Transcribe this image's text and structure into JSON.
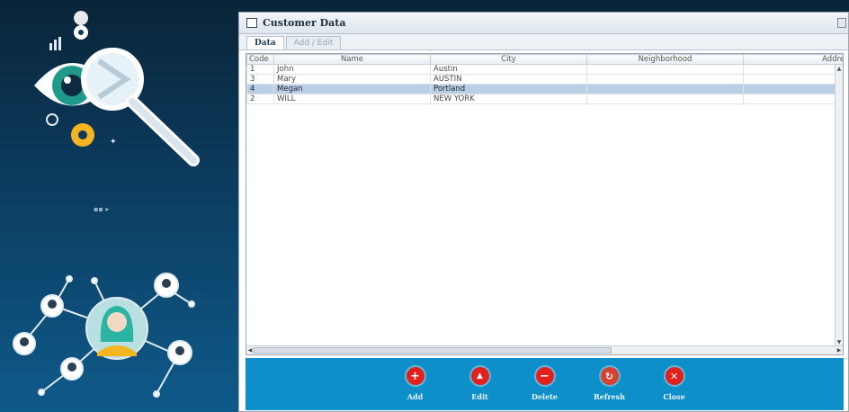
{
  "window": {
    "title": "Customer Data",
    "tabs": [
      "Data",
      "Add / Edit"
    ]
  },
  "table": {
    "columns": [
      "Code",
      "Name",
      "City",
      "Neighborhood",
      "Address"
    ],
    "rows": [
      {
        "code": "1",
        "name": "John",
        "city": "Austin",
        "neighborhood": "",
        "address": ""
      },
      {
        "code": "3",
        "name": "Mary",
        "city": "AUSTIN",
        "neighborhood": "",
        "address": ""
      },
      {
        "code": "4",
        "name": "Megan",
        "city": "Portland",
        "neighborhood": "",
        "address": "",
        "selected": true
      },
      {
        "code": "2",
        "name": "WILL",
        "city": "NEW YORK",
        "neighborhood": "",
        "address": ""
      }
    ]
  },
  "toolbar": {
    "add": "Add",
    "edit": "Edit",
    "delete": "Delete",
    "refresh": "Refresh",
    "close": "Close"
  },
  "icons": {
    "add": "plus-circle-icon",
    "edit": "up-arrow-circle-icon",
    "delete": "minus-circle-icon",
    "refresh": "refresh-circle-icon",
    "close": "x-circle-icon"
  },
  "colors": {
    "toolbar_bg": "#0e8fc9",
    "icon_red": "#e3201b",
    "selected_row": "#b8cfe6"
  }
}
